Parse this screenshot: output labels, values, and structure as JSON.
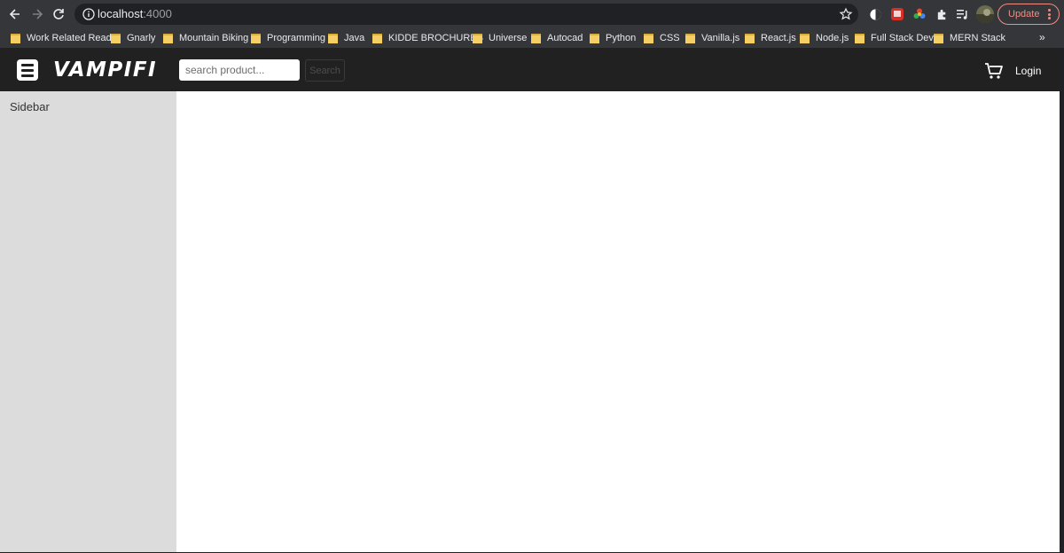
{
  "browser": {
    "url_host": "localhost",
    "url_port": ":4000",
    "update_label": "Update",
    "icons": [
      "back-icon",
      "forward-icon",
      "reload-icon",
      "info-icon",
      "star-icon",
      "extension-icons",
      "puzzle-icon",
      "media-icon",
      "profile-avatar"
    ]
  },
  "bookmarks": {
    "items": [
      {
        "label": "Work Related Reads"
      },
      {
        "label": "Gnarly"
      },
      {
        "label": "Mountain Biking"
      },
      {
        "label": "Programming"
      },
      {
        "label": "Java"
      },
      {
        "label": "KIDDE BROCHURES"
      },
      {
        "label": "Universe"
      },
      {
        "label": "Autocad"
      },
      {
        "label": "Python"
      },
      {
        "label": "CSS"
      },
      {
        "label": "Vanilla.js"
      },
      {
        "label": "React.js"
      },
      {
        "label": "Node.js"
      },
      {
        "label": "Full Stack Dev"
      },
      {
        "label": "MERN Stack"
      }
    ],
    "more": "»"
  },
  "header": {
    "brand": "VAMPIFI",
    "search_placeholder": "search product...",
    "search_button": "Search",
    "login": "Login"
  },
  "sidebar": {
    "title": "Sidebar"
  },
  "colors": {
    "header_bg": "#212121",
    "sidebar_bg": "#dcdcdc",
    "update_accent": "#f28b82"
  }
}
